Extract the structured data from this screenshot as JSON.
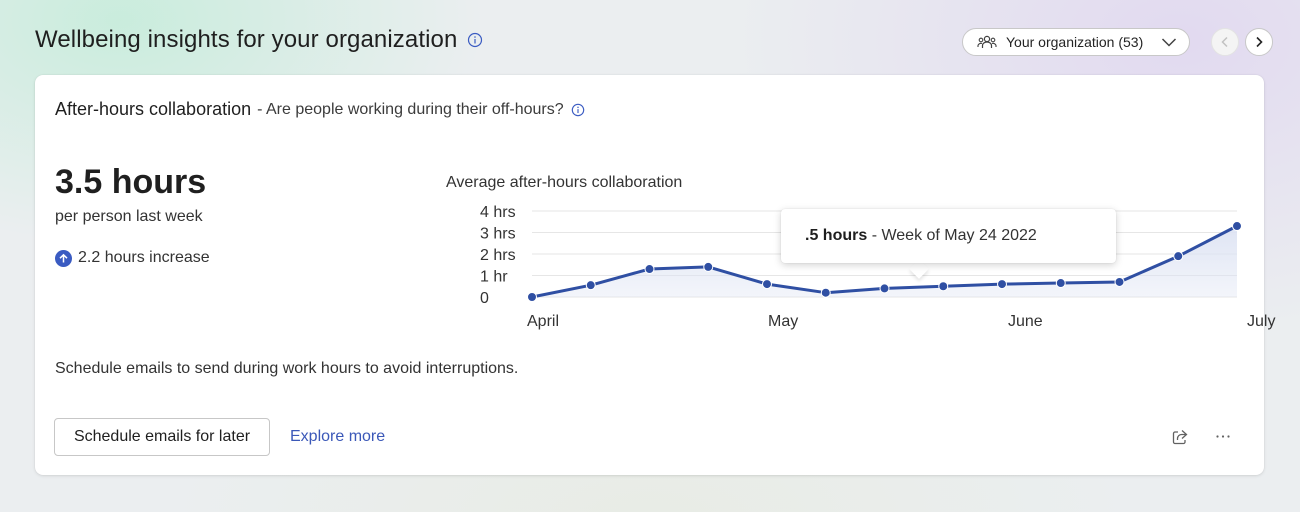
{
  "page": {
    "title": "Wellbeing insights for your organization"
  },
  "header": {
    "org_selector": "Your organization (53)"
  },
  "card": {
    "title": "After-hours collaboration",
    "subtitle": "- Are people working during their off-hours?",
    "metric_value": "3.5 hours",
    "metric_caption": "per person last week",
    "change_text": "2.2 hours increase",
    "tip": "Schedule emails to send during work hours to avoid interruptions.",
    "primary_action": "Schedule emails for later",
    "secondary_action": "Explore more"
  },
  "tooltip": {
    "value": ".5 hours",
    "label": "- Week of May 24 2022"
  },
  "chart_data": {
    "type": "area",
    "title": "Average after-hours collaboration",
    "xlabel": "",
    "ylabel": "",
    "y_ticks": [
      "4 hrs",
      "3 hrs",
      "2 hrs",
      "1 hr",
      "0"
    ],
    "y_tick_values": [
      4,
      3,
      2,
      1,
      0
    ],
    "x_tick_labels": [
      "April",
      "May",
      "June",
      "July"
    ],
    "ylim": [
      0,
      4
    ],
    "grid": true,
    "color": "#2f4fa3",
    "fill_color": "#dde3f3",
    "points": [
      0.0,
      0.55,
      1.3,
      1.4,
      0.6,
      0.2,
      0.4,
      0.5,
      0.6,
      0.65,
      0.7,
      1.9,
      3.3
    ],
    "highlighted_index": 7
  }
}
